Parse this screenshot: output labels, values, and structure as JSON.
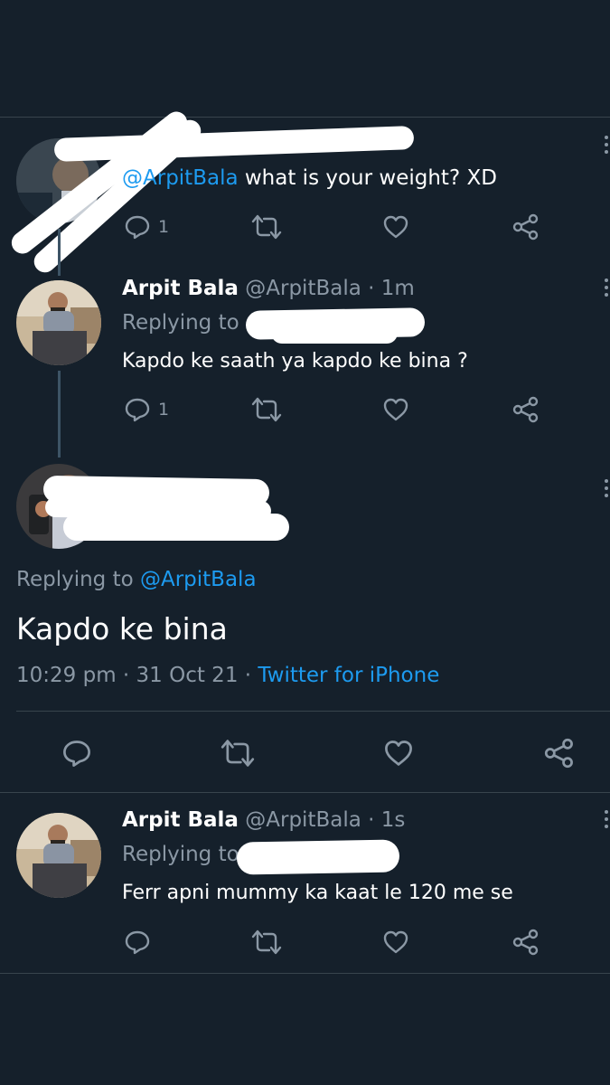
{
  "tweets": [
    {
      "reply_text_mention": "@ArpitBala",
      "reply_text_body": " what is your weight? XD",
      "reply_count": "1"
    },
    {
      "name": "Arpit Bala",
      "handle": "@ArpitBala",
      "time": " · 1m",
      "replying_label": "Replying to",
      "body": "Kapdo ke saath ya kapdo ke bina ?",
      "reply_count": "1"
    },
    {
      "replying_label": "Replying to ",
      "replying_handle": "@ArpitBala",
      "body": "Kapdo ke bina",
      "timestamp": "10:29 pm · 31 Oct 21 · ",
      "source": "Twitter for iPhone"
    },
    {
      "name": "Arpit Bala",
      "handle": "@ArpitBala",
      "time": " · 1s",
      "replying_label": "Replying to",
      "body": "Ferr apni mummy ka kaat le 120 me se"
    }
  ],
  "icons": {
    "reply": "reply-icon",
    "retweet": "retweet-icon",
    "like": "heart-icon",
    "share": "share-icon",
    "more": "more-icon"
  },
  "colors": {
    "background": "#15202b",
    "link": "#1d9bf0",
    "muted": "#8b98a5",
    "divider": "#38444d",
    "redaction": "#ffffff"
  }
}
